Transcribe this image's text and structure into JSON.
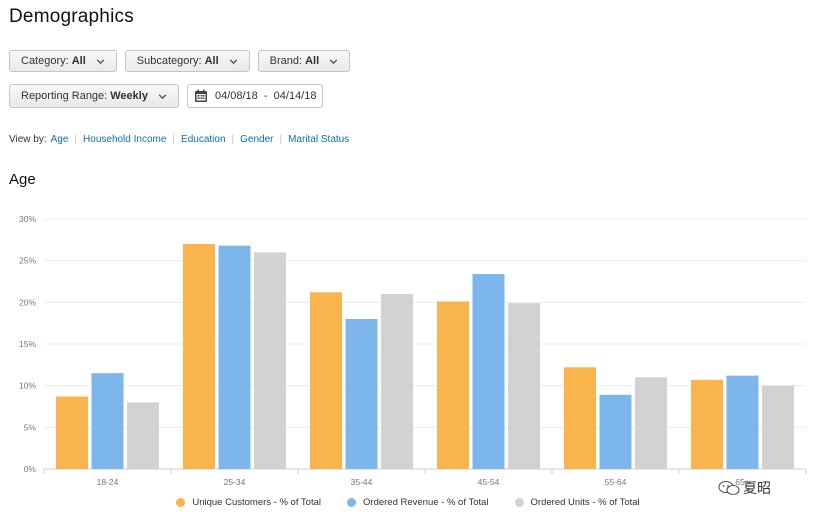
{
  "page": {
    "title": "Demographics"
  },
  "filters": {
    "category": {
      "label": "Category:",
      "value": "All"
    },
    "subcategory": {
      "label": "Subcategory:",
      "value": "All"
    },
    "brand": {
      "label": "Brand:",
      "value": "All"
    },
    "reporting_range": {
      "label": "Reporting Range:",
      "value": "Weekly"
    },
    "date_range": "04/08/18  -  04/14/18"
  },
  "view_by": {
    "label": "View by:",
    "options": [
      "Age",
      "Household Income",
      "Education",
      "Gender",
      "Marital Status"
    ]
  },
  "section_title": "Age",
  "colors": {
    "unique_customers": "#f9b44d",
    "ordered_revenue": "#7db6ea",
    "ordered_units": "#d2d2d2",
    "link": "#0f6fb3"
  },
  "icons": {
    "dropdown": "chevron-down-icon",
    "calendar": "calendar-icon"
  },
  "chart_data": {
    "type": "bar",
    "categories": [
      "18-24",
      "25-34",
      "35-44",
      "45-54",
      "55-64",
      "65+"
    ],
    "series": [
      {
        "name": "Unique Customers - % of Total",
        "color": "#f9b44d",
        "values": [
          8.7,
          27,
          21.2,
          20.1,
          12.2,
          10.7
        ]
      },
      {
        "name": "Ordered Revenue - % of Total",
        "color": "#7db6ea",
        "values": [
          11.5,
          26.8,
          18,
          23.4,
          8.9,
          11.2
        ]
      },
      {
        "name": "Ordered Units - % of Total",
        "color": "#d2d2d2",
        "values": [
          8,
          26,
          21,
          19.9,
          11,
          10
        ]
      }
    ],
    "yticks": [
      "30%",
      "25%",
      "20%",
      "15%",
      "10%",
      "5%",
      "0%"
    ],
    "ylim": [
      0,
      30
    ],
    "grid": true,
    "legend_position": "bottom"
  },
  "watermark": {
    "text": "夏昭"
  }
}
